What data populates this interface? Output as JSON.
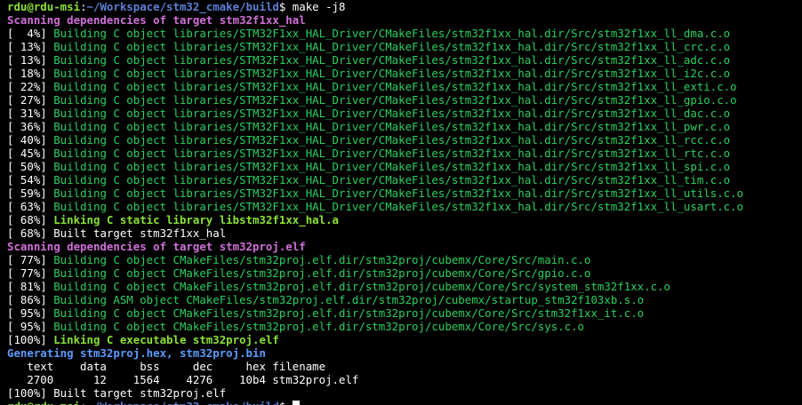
{
  "colors": {
    "background": "#000000",
    "default_text": "#ffffff",
    "prompt_user": "#8ae234",
    "prompt_path": "#5c7fd6",
    "progress_bracket": "#ffffff",
    "building": "#2bd15f",
    "scanning": "#d070d8",
    "linking": "#8ae234",
    "generating": "#5c9cff",
    "cursor": "#ffffff"
  },
  "terminal": {
    "lines": [
      {
        "kind": "prompt",
        "user": "rdu@rdu-msi",
        "sep": ":",
        "path": "~/Workspace/stm32_cmake/build",
        "symbol": "$",
        "command": " make -j8"
      },
      {
        "kind": "scan",
        "text": "Scanning dependencies of target stm32f1xx_hal"
      },
      {
        "kind": "build",
        "progress": "[  4%]",
        "text": " Building C object libraries/STM32F1xx_HAL_Driver/CMakeFiles/stm32f1xx_hal.dir/Src/stm32f1xx_ll_dma.c.o"
      },
      {
        "kind": "build",
        "progress": "[ 13%]",
        "text": " Building C object libraries/STM32F1xx_HAL_Driver/CMakeFiles/stm32f1xx_hal.dir/Src/stm32f1xx_ll_crc.c.o"
      },
      {
        "kind": "build",
        "progress": "[ 13%]",
        "text": " Building C object libraries/STM32F1xx_HAL_Driver/CMakeFiles/stm32f1xx_hal.dir/Src/stm32f1xx_ll_adc.c.o"
      },
      {
        "kind": "build",
        "progress": "[ 18%]",
        "text": " Building C object libraries/STM32F1xx_HAL_Driver/CMakeFiles/stm32f1xx_hal.dir/Src/stm32f1xx_ll_i2c.c.o"
      },
      {
        "kind": "build",
        "progress": "[ 22%]",
        "text": " Building C object libraries/STM32F1xx_HAL_Driver/CMakeFiles/stm32f1xx_hal.dir/Src/stm32f1xx_ll_exti.c.o"
      },
      {
        "kind": "build",
        "progress": "[ 27%]",
        "text": " Building C object libraries/STM32F1xx_HAL_Driver/CMakeFiles/stm32f1xx_hal.dir/Src/stm32f1xx_ll_gpio.c.o"
      },
      {
        "kind": "build",
        "progress": "[ 31%]",
        "text": " Building C object libraries/STM32F1xx_HAL_Driver/CMakeFiles/stm32f1xx_hal.dir/Src/stm32f1xx_ll_dac.c.o"
      },
      {
        "kind": "build",
        "progress": "[ 36%]",
        "text": " Building C object libraries/STM32F1xx_HAL_Driver/CMakeFiles/stm32f1xx_hal.dir/Src/stm32f1xx_ll_pwr.c.o"
      },
      {
        "kind": "build",
        "progress": "[ 40%]",
        "text": " Building C object libraries/STM32F1xx_HAL_Driver/CMakeFiles/stm32f1xx_hal.dir/Src/stm32f1xx_ll_rcc.c.o"
      },
      {
        "kind": "build",
        "progress": "[ 45%]",
        "text": " Building C object libraries/STM32F1xx_HAL_Driver/CMakeFiles/stm32f1xx_hal.dir/Src/stm32f1xx_ll_rtc.c.o"
      },
      {
        "kind": "build",
        "progress": "[ 50%]",
        "text": " Building C object libraries/STM32F1xx_HAL_Driver/CMakeFiles/stm32f1xx_hal.dir/Src/stm32f1xx_ll_spi.c.o"
      },
      {
        "kind": "build",
        "progress": "[ 54%]",
        "text": " Building C object libraries/STM32F1xx_HAL_Driver/CMakeFiles/stm32f1xx_hal.dir/Src/stm32f1xx_ll_tim.c.o"
      },
      {
        "kind": "build",
        "progress": "[ 59%]",
        "text": " Building C object libraries/STM32F1xx_HAL_Driver/CMakeFiles/stm32f1xx_hal.dir/Src/stm32f1xx_ll_utils.c.o"
      },
      {
        "kind": "build",
        "progress": "[ 63%]",
        "text": " Building C object libraries/STM32F1xx_HAL_Driver/CMakeFiles/stm32f1xx_hal.dir/Src/stm32f1xx_ll_usart.c.o"
      },
      {
        "kind": "link",
        "progress": "[ 68%]",
        "text": " Linking C static library libstm32f1xx_hal.a"
      },
      {
        "kind": "built",
        "progress": "[ 68%]",
        "text": " Built target stm32f1xx_hal"
      },
      {
        "kind": "scan",
        "text": "Scanning dependencies of target stm32proj.elf"
      },
      {
        "kind": "build",
        "progress": "[ 77%]",
        "text": " Building C object CMakeFiles/stm32proj.elf.dir/stm32proj/cubemx/Core/Src/main.c.o"
      },
      {
        "kind": "build",
        "progress": "[ 77%]",
        "text": " Building C object CMakeFiles/stm32proj.elf.dir/stm32proj/cubemx/Core/Src/gpio.c.o"
      },
      {
        "kind": "build",
        "progress": "[ 81%]",
        "text": " Building C object CMakeFiles/stm32proj.elf.dir/stm32proj/cubemx/Core/Src/system_stm32f1xx.c.o"
      },
      {
        "kind": "build",
        "progress": "[ 86%]",
        "text": " Building ASM object CMakeFiles/stm32proj.elf.dir/stm32proj/cubemx/startup_stm32f103xb.s.o"
      },
      {
        "kind": "build",
        "progress": "[ 95%]",
        "text": " Building C object CMakeFiles/stm32proj.elf.dir/stm32proj/cubemx/Core/Src/stm32f1xx_it.c.o"
      },
      {
        "kind": "build",
        "progress": "[ 95%]",
        "text": " Building C object CMakeFiles/stm32proj.elf.dir/stm32proj/cubemx/Core/Src/sys.c.o"
      },
      {
        "kind": "link",
        "progress": "[100%]",
        "text": " Linking C executable stm32proj.elf"
      },
      {
        "kind": "gen",
        "text": "Generating stm32proj.hex, stm32proj.bin"
      },
      {
        "kind": "plain",
        "text": "   text    data     bss     dec     hex filename"
      },
      {
        "kind": "plain",
        "text": "   2700      12    1564    4276    10b4 stm32proj.elf"
      },
      {
        "kind": "built",
        "progress": "[100%]",
        "text": " Built target stm32proj.elf"
      },
      {
        "kind": "prompt",
        "user": "rdu@rdu-msi",
        "sep": ":",
        "path": "~/Workspace/stm32_cmake/build",
        "symbol": "$",
        "command": " ",
        "cursor": true
      }
    ]
  }
}
